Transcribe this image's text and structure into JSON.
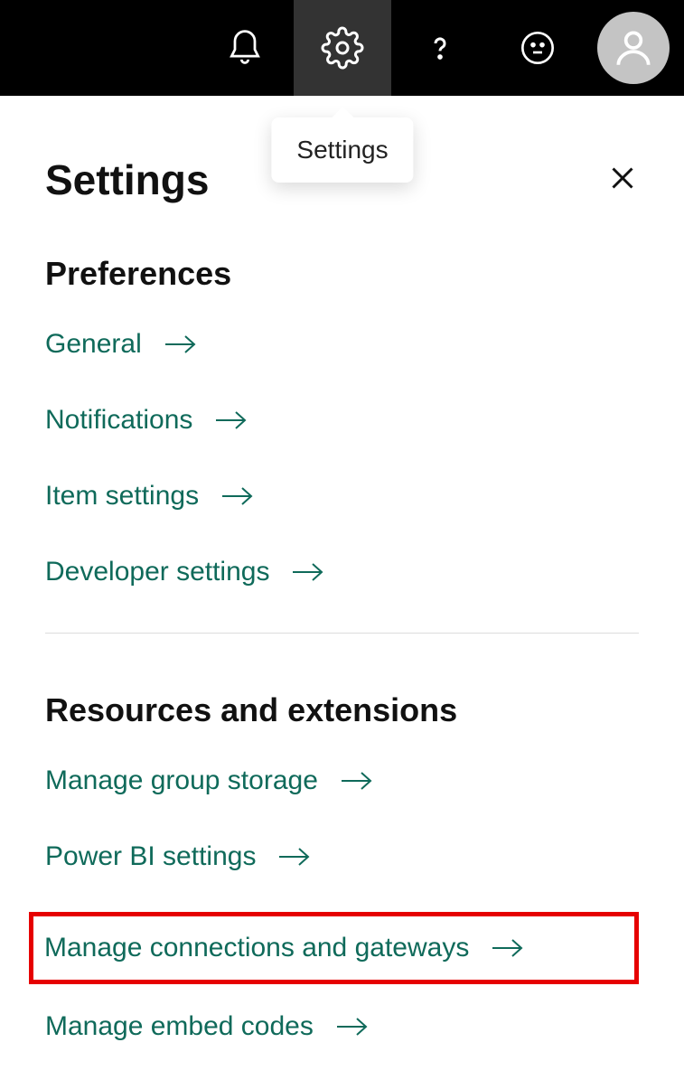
{
  "tooltip": "Settings",
  "panel": {
    "title": "Settings",
    "sections": [
      {
        "title": "Preferences",
        "links": [
          "General",
          "Notifications",
          "Item settings",
          "Developer settings"
        ]
      },
      {
        "title": "Resources and extensions",
        "links": [
          "Manage group storage",
          "Power BI settings",
          "Manage connections and gateways",
          "Manage embed codes"
        ]
      }
    ]
  }
}
